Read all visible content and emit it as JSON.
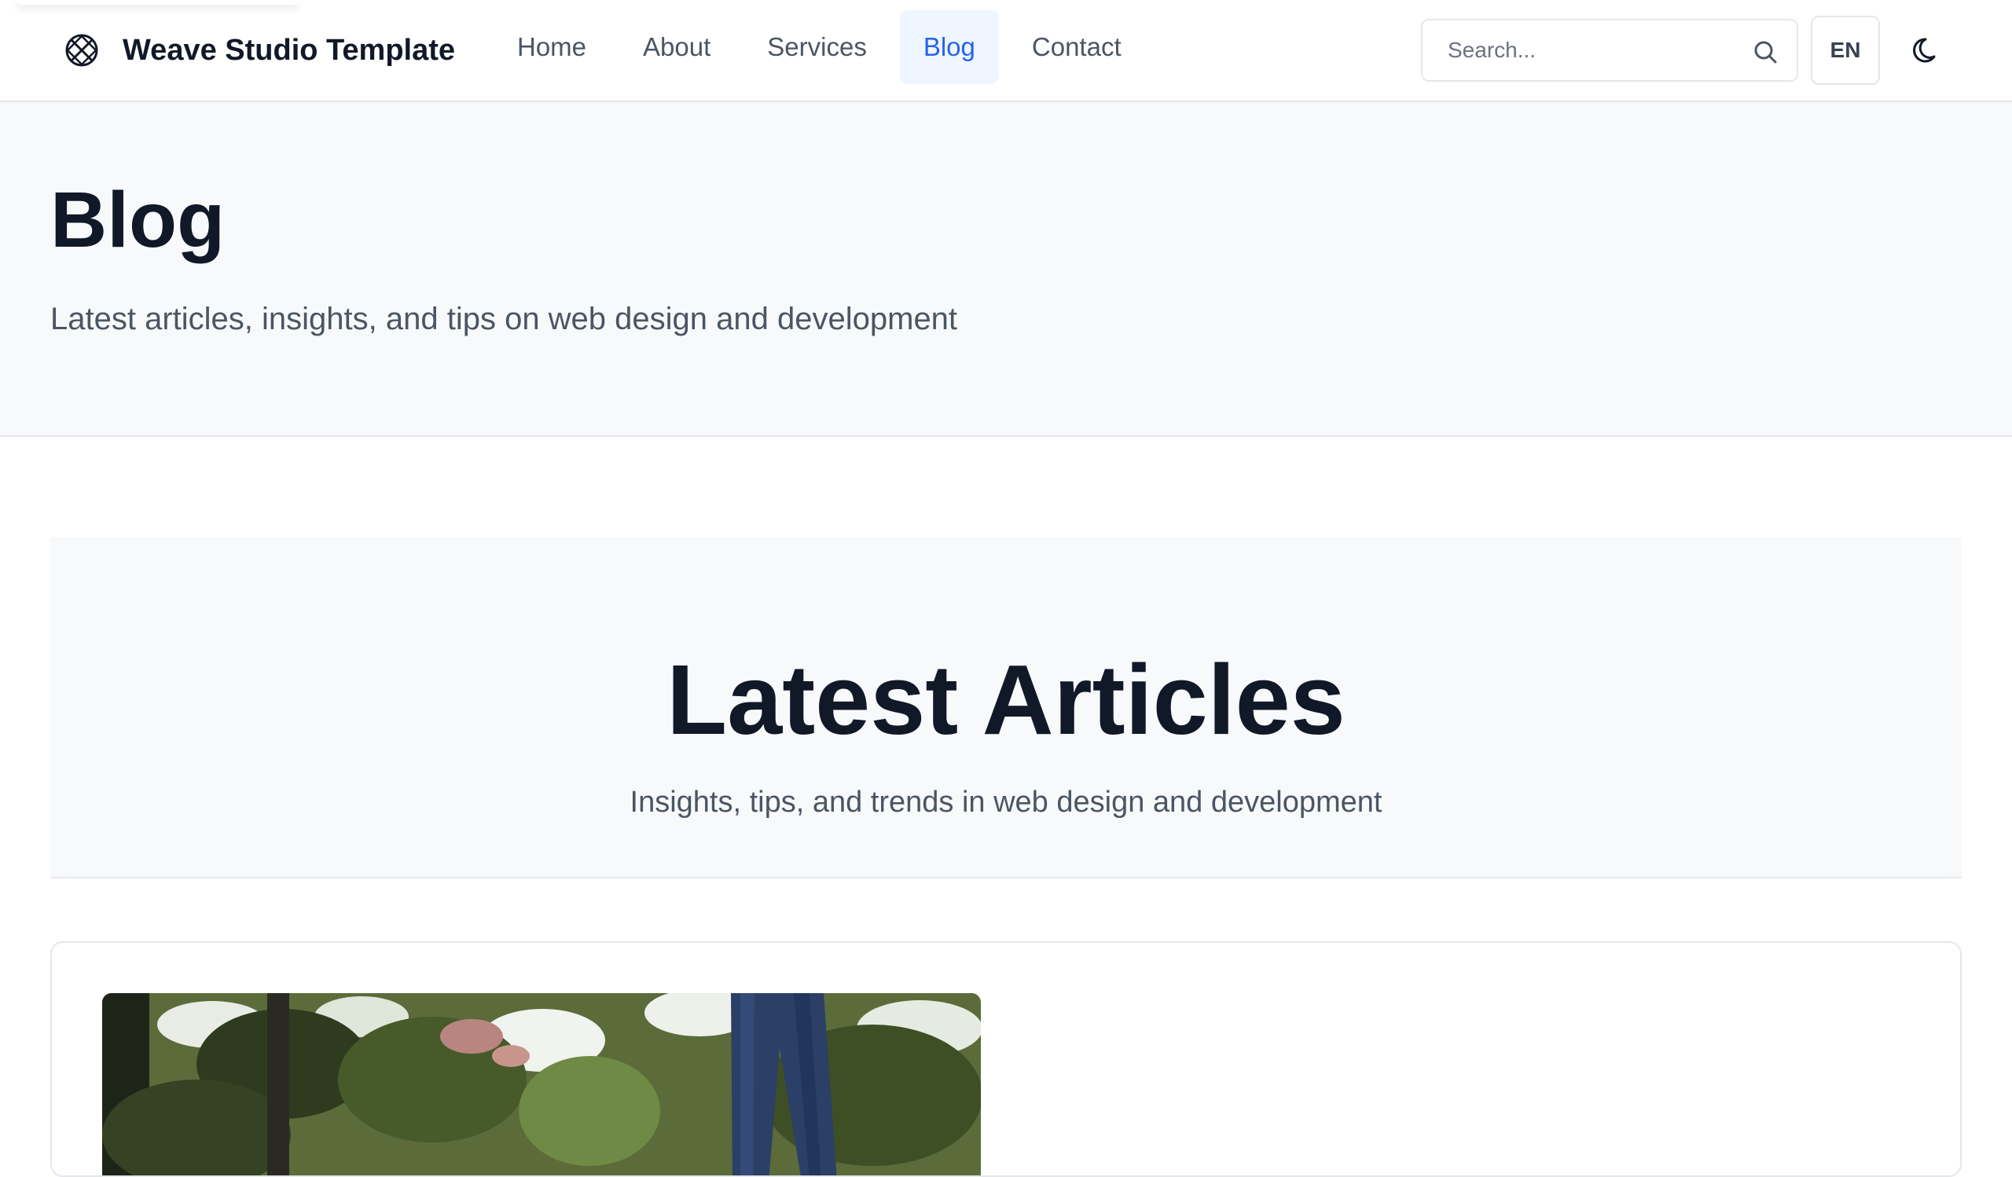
{
  "header": {
    "brand_name": "Weave Studio Template",
    "brand_icon": "weave-logo-icon",
    "nav": [
      {
        "label": "Home",
        "active": false
      },
      {
        "label": "About",
        "active": false
      },
      {
        "label": "Services",
        "active": false
      },
      {
        "label": "Blog",
        "active": true
      },
      {
        "label": "Contact",
        "active": false
      }
    ],
    "search": {
      "placeholder": "Search...",
      "icon": "search-icon"
    },
    "language": "EN",
    "theme_icon": "moon-icon"
  },
  "hero": {
    "title": "Blog",
    "subtitle": "Latest articles, insights, and tips on web design and development"
  },
  "articles": {
    "title": "Latest Articles",
    "subtitle": "Insights, tips, and trends in web design and development"
  },
  "colors": {
    "accent": "#2563eb",
    "accent_bg": "#eff6ff",
    "text_primary": "#111827",
    "text_secondary": "#4b5563",
    "surface_muted": "#f8f9fb",
    "border": "#e5e7eb"
  }
}
